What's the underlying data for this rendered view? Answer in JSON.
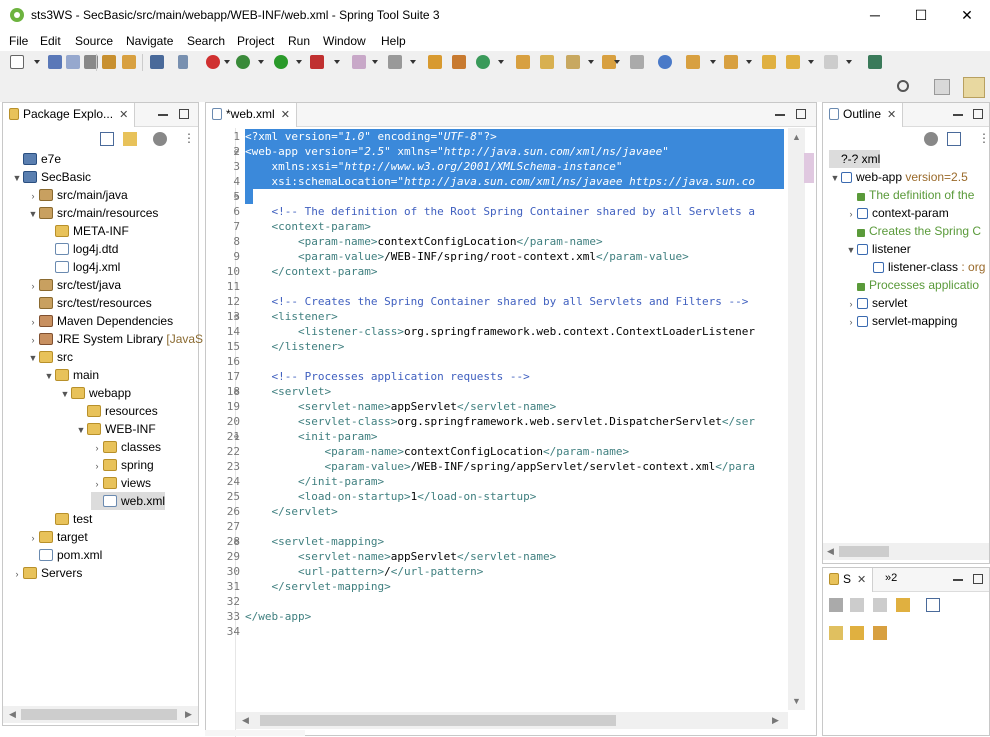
{
  "window": {
    "title": "sts3WS - SecBasic/src/main/webapp/WEB-INF/web.xml - Spring Tool Suite 3",
    "minimize": "─",
    "maximize": "☐",
    "close": "✕"
  },
  "menu": [
    "File",
    "Edit",
    "Source",
    "Navigate",
    "Search",
    "Project",
    "Run",
    "Window",
    "Help"
  ],
  "package_explorer": {
    "tab_label": "Package Explo...",
    "close": "✕",
    "tree": [
      {
        "label": "e7e",
        "icon": "proj"
      },
      {
        "label": "SecBasic",
        "icon": "proj"
      },
      {
        "label": "src/main/java",
        "icon": "pkg"
      },
      {
        "label": "src/main/resources",
        "icon": "pkg"
      },
      {
        "label": "META-INF",
        "icon": "folder"
      },
      {
        "label": "log4j.dtd",
        "icon": "file"
      },
      {
        "label": "log4j.xml",
        "icon": "file"
      },
      {
        "label": "src/test/java",
        "icon": "pkg"
      },
      {
        "label": "src/test/resources",
        "icon": "pkg"
      },
      {
        "label": "Maven Dependencies",
        "icon": "lib"
      },
      {
        "label": "JRE System Library",
        "suffix": "[JavaS",
        "icon": "lib"
      },
      {
        "label": "src",
        "icon": "folder"
      },
      {
        "label": "main",
        "icon": "folder"
      },
      {
        "label": "webapp",
        "icon": "folder"
      },
      {
        "label": "resources",
        "icon": "folder"
      },
      {
        "label": "WEB-INF",
        "icon": "folder"
      },
      {
        "label": "classes",
        "icon": "folder"
      },
      {
        "label": "spring",
        "icon": "folder"
      },
      {
        "label": "views",
        "icon": "folder"
      },
      {
        "label": "web.xml",
        "icon": "file"
      },
      {
        "label": "test",
        "icon": "folder"
      },
      {
        "label": "target",
        "icon": "folder"
      },
      {
        "label": "pom.xml",
        "icon": "file"
      },
      {
        "label": "Servers",
        "icon": "folder"
      }
    ]
  },
  "editor": {
    "tab_label": "*web.xml",
    "close": "✕",
    "lines": [
      {
        "n": "1",
        "parts": [
          [
            "tag",
            "<?xml "
          ],
          [
            "attr",
            "version"
          ],
          [
            "txt",
            "="
          ],
          [
            "str",
            "\"1.0\""
          ],
          [
            "txt",
            " "
          ],
          [
            "attr",
            "encoding"
          ],
          [
            "txt",
            "="
          ],
          [
            "str",
            "\"UTF-8\""
          ],
          [
            "tag",
            "?>"
          ]
        ]
      },
      {
        "n": "2",
        "parts": [
          [
            "tag",
            "<web-app "
          ],
          [
            "attr",
            "version"
          ],
          [
            "txt",
            "="
          ],
          [
            "str",
            "\"2.5\""
          ],
          [
            "txt",
            " "
          ],
          [
            "attr",
            "xmlns"
          ],
          [
            "txt",
            "="
          ],
          [
            "str",
            "\"http://java.sun.com/xml/ns/javaee\""
          ]
        ]
      },
      {
        "n": "3",
        "parts": [
          [
            "txt",
            "    "
          ],
          [
            "attr",
            "xmlns:xsi"
          ],
          [
            "txt",
            "="
          ],
          [
            "str",
            "\"http://www.w3.org/2001/XMLSchema-instance\""
          ]
        ]
      },
      {
        "n": "4",
        "parts": [
          [
            "txt",
            "    "
          ],
          [
            "attr",
            "xsi:schemaLocation"
          ],
          [
            "txt",
            "="
          ],
          [
            "str",
            "\"http://java.sun.com/xml/ns/javaee https://java.sun.co"
          ]
        ]
      },
      {
        "n": "5",
        "parts": [
          [
            "txt",
            ""
          ]
        ]
      },
      {
        "n": "6",
        "parts": [
          [
            "txt",
            "    "
          ],
          [
            "cmt",
            "<!-- The definition of the Root Spring Container shared by all Servlets a"
          ]
        ]
      },
      {
        "n": "7",
        "parts": [
          [
            "txt",
            "    "
          ],
          [
            "tag",
            "<context-param>"
          ]
        ]
      },
      {
        "n": "8",
        "parts": [
          [
            "txt",
            "        "
          ],
          [
            "tag",
            "<param-name>"
          ],
          [
            "txt",
            "contextConfigLocation"
          ],
          [
            "tag",
            "</param-name>"
          ]
        ]
      },
      {
        "n": "9",
        "parts": [
          [
            "txt",
            "        "
          ],
          [
            "tag",
            "<param-value>"
          ],
          [
            "txt",
            "/WEB-INF/spring/root-context.xml"
          ],
          [
            "tag",
            "</param-value>"
          ]
        ]
      },
      {
        "n": "10",
        "parts": [
          [
            "txt",
            "    "
          ],
          [
            "tag",
            "</context-param>"
          ]
        ]
      },
      {
        "n": "11",
        "parts": [
          [
            "txt",
            ""
          ]
        ]
      },
      {
        "n": "12",
        "parts": [
          [
            "txt",
            "    "
          ],
          [
            "cmt",
            "<!-- Creates the Spring Container shared by all Servlets and Filters -->"
          ]
        ]
      },
      {
        "n": "13",
        "parts": [
          [
            "txt",
            "    "
          ],
          [
            "tag",
            "<listener>"
          ]
        ]
      },
      {
        "n": "14",
        "parts": [
          [
            "txt",
            "        "
          ],
          [
            "tag",
            "<listener-class>"
          ],
          [
            "txt",
            "org.springframework.web.context.ContextLoaderListener"
          ]
        ]
      },
      {
        "n": "15",
        "parts": [
          [
            "txt",
            "    "
          ],
          [
            "tag",
            "</listener>"
          ]
        ]
      },
      {
        "n": "16",
        "parts": [
          [
            "txt",
            ""
          ]
        ]
      },
      {
        "n": "17",
        "parts": [
          [
            "txt",
            "    "
          ],
          [
            "cmt",
            "<!-- Processes application requests -->"
          ]
        ]
      },
      {
        "n": "18",
        "parts": [
          [
            "txt",
            "    "
          ],
          [
            "tag",
            "<servlet>"
          ]
        ]
      },
      {
        "n": "19",
        "parts": [
          [
            "txt",
            "        "
          ],
          [
            "tag",
            "<servlet-name>"
          ],
          [
            "txt",
            "appServlet"
          ],
          [
            "tag",
            "</servlet-name>"
          ]
        ]
      },
      {
        "n": "20",
        "parts": [
          [
            "txt",
            "        "
          ],
          [
            "tag",
            "<servlet-class>"
          ],
          [
            "txt",
            "org.springframework.web.servlet.DispatcherServlet"
          ],
          [
            "tag",
            "</ser"
          ]
        ]
      },
      {
        "n": "21",
        "parts": [
          [
            "txt",
            "        "
          ],
          [
            "tag",
            "<init-param>"
          ]
        ]
      },
      {
        "n": "22",
        "parts": [
          [
            "txt",
            "            "
          ],
          [
            "tag",
            "<param-name>"
          ],
          [
            "txt",
            "contextConfigLocation"
          ],
          [
            "tag",
            "</param-name>"
          ]
        ]
      },
      {
        "n": "23",
        "parts": [
          [
            "txt",
            "            "
          ],
          [
            "tag",
            "<param-value>"
          ],
          [
            "txt",
            "/WEB-INF/spring/appServlet/servlet-context.xml"
          ],
          [
            "tag",
            "</para"
          ]
        ]
      },
      {
        "n": "24",
        "parts": [
          [
            "txt",
            "        "
          ],
          [
            "tag",
            "</init-param>"
          ]
        ]
      },
      {
        "n": "25",
        "parts": [
          [
            "txt",
            "        "
          ],
          [
            "tag",
            "<load-on-startup>"
          ],
          [
            "txt",
            "1"
          ],
          [
            "tag",
            "</load-on-startup>"
          ]
        ]
      },
      {
        "n": "26",
        "parts": [
          [
            "txt",
            "    "
          ],
          [
            "tag",
            "</servlet>"
          ]
        ]
      },
      {
        "n": "27",
        "parts": [
          [
            "txt",
            ""
          ]
        ]
      },
      {
        "n": "28",
        "parts": [
          [
            "txt",
            "    "
          ],
          [
            "tag",
            "<servlet-mapping>"
          ]
        ]
      },
      {
        "n": "29",
        "parts": [
          [
            "txt",
            "        "
          ],
          [
            "tag",
            "<servlet-name>"
          ],
          [
            "txt",
            "appServlet"
          ],
          [
            "tag",
            "</servlet-name>"
          ]
        ]
      },
      {
        "n": "30",
        "parts": [
          [
            "txt",
            "        "
          ],
          [
            "tag",
            "<url-pattern>"
          ],
          [
            "txt",
            "/"
          ],
          [
            "tag",
            "</url-pattern>"
          ]
        ]
      },
      {
        "n": "31",
        "parts": [
          [
            "txt",
            "    "
          ],
          [
            "tag",
            "</servlet-mapping>"
          ]
        ]
      },
      {
        "n": "32",
        "parts": [
          [
            "txt",
            ""
          ]
        ]
      },
      {
        "n": "33",
        "parts": [
          [
            "tag",
            "</web-app>"
          ]
        ]
      },
      {
        "n": "34",
        "parts": [
          [
            "txt",
            ""
          ]
        ]
      }
    ],
    "selected_lines": 5
  },
  "outline": {
    "tab_label": "Outline",
    "close": "✕",
    "tree": [
      {
        "label": "?-? xml",
        "kind": "pi"
      },
      {
        "label": "web-app",
        "attr": " version=2.5",
        "kind": "e"
      },
      {
        "label": "The definition of the",
        "kind": "c"
      },
      {
        "label": "context-param",
        "kind": "e"
      },
      {
        "label": "Creates the Spring C",
        "kind": "c"
      },
      {
        "label": "listener",
        "kind": "e"
      },
      {
        "label": "listener-class",
        "attr": " : org",
        "kind": "e"
      },
      {
        "label": "Processes applicatio",
        "kind": "c"
      },
      {
        "label": "servlet",
        "kind": "e"
      },
      {
        "label": "servlet-mapping",
        "kind": "e"
      }
    ]
  },
  "servers_panel": {
    "tab_label": "S",
    "close": "✕",
    "more": "»2"
  }
}
